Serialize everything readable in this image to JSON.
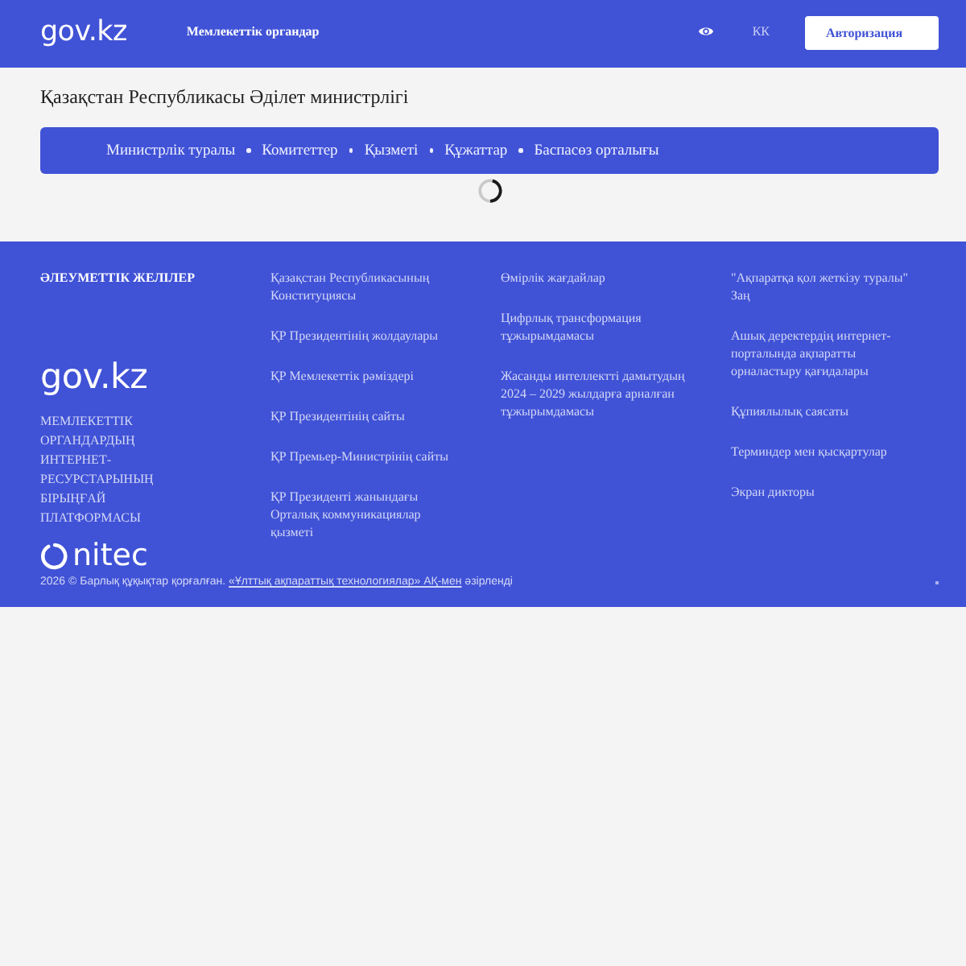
{
  "header": {
    "logo": "gov.kz",
    "menu_label": "Мемлекеттік органдар",
    "language": {
      "label": "КК",
      "selected": true
    },
    "login_button": "Авторизация"
  },
  "page": {
    "title": "Қазақстан Республикасы Әділет министрлігі",
    "nav": [
      "Министрлік туралы",
      "Комитеттер",
      "Қызметі",
      "Құжаттар",
      "Баспасөз орталығы"
    ]
  },
  "footer": {
    "social_heading": "ӘЛЕУМЕТТІК ЖЕЛІЛЕР",
    "logo": "gov.kz",
    "platform_text": "МЕМЛЕКЕТТІК ОРГАНДАРДЫҢ ИНТЕРНЕТ-РЕСУРСТАРЫНЫҢ БІРЫҢҒАЙ ПЛАТФОРМАСЫ",
    "link_columns": [
      [
        "Қазақстан Республикасының Конституциясы",
        "ҚР Президентінің жолдаулары",
        "ҚР Мемлекеттік рәміздері",
        "ҚР Президентінің сайты",
        "ҚР Премьер-Министрінің сайты",
        "ҚР Президенті жанындағы Орталық коммуникациялар қызметі"
      ],
      [
        "Өмірлік жағдайлар",
        "Цифрлық трансформация тұжырымдамасы",
        "Жасанды интеллектті дамытудың 2024 – 2029 жылдарға арналған тұжырымдамасы"
      ],
      [
        "\"Ақпаратқа қол жеткізу туралы\" Заң",
        "Ашық деректердің интернет-порталында ақпаратты орналастыру қағидалары",
        "Құпиялылық саясаты",
        "Терминдер мен қысқартулар",
        "Экран дикторы"
      ]
    ],
    "developer_logo": "nitec",
    "copyright": {
      "text": "2026 © Барлық құқықтар қорғалған.",
      "link": "«Ұлттық ақпараттық технологиялар» АҚ-мен",
      "after": "әзірленді"
    }
  }
}
